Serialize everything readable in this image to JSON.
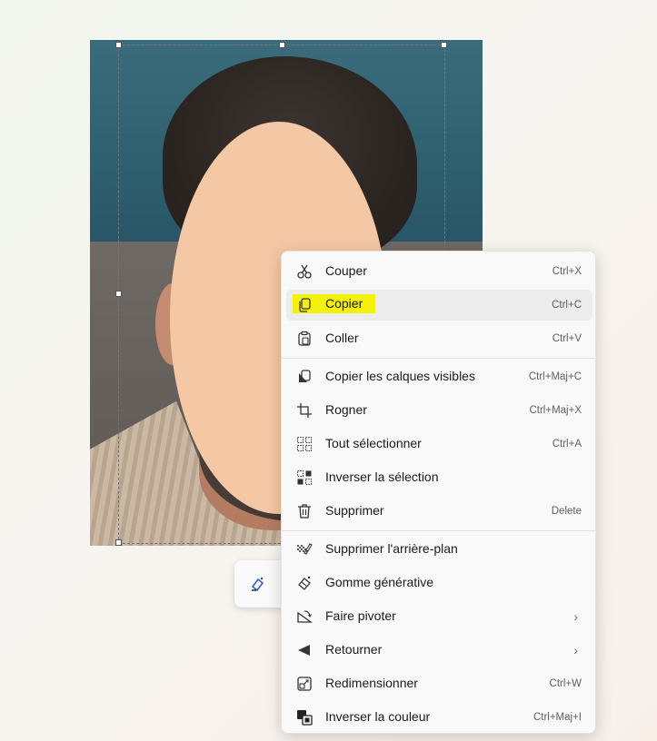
{
  "menu": {
    "items": [
      {
        "label": "Couper",
        "shortcut": "Ctrl+X",
        "icon": "scissors-icon"
      },
      {
        "label": "Copier",
        "shortcut": "Ctrl+C",
        "icon": "copy-icon",
        "highlighted": true
      },
      {
        "label": "Coller",
        "shortcut": "Ctrl+V",
        "icon": "paste-icon"
      },
      {
        "label": "Copier les calques visibles",
        "shortcut": "Ctrl+Maj+C",
        "icon": "copy-layers-icon"
      },
      {
        "label": "Rogner",
        "shortcut": "Ctrl+Maj+X",
        "icon": "crop-icon"
      },
      {
        "label": "Tout sélectionner",
        "shortcut": "Ctrl+A",
        "icon": "select-all-icon"
      },
      {
        "label": "Inverser la sélection",
        "shortcut": "",
        "icon": "invert-selection-icon"
      },
      {
        "label": "Supprimer",
        "shortcut": "Delete",
        "icon": "trash-icon"
      },
      {
        "label": "Supprimer l'arrière-plan",
        "shortcut": "",
        "icon": "remove-background-icon"
      },
      {
        "label": "Gomme générative",
        "shortcut": "",
        "icon": "generative-eraser-icon"
      },
      {
        "label": "Faire pivoter",
        "shortcut": "",
        "icon": "rotate-icon",
        "submenu": true
      },
      {
        "label": "Retourner",
        "shortcut": "",
        "icon": "flip-icon",
        "submenu": true
      },
      {
        "label": "Redimensionner",
        "shortcut": "Ctrl+W",
        "icon": "resize-icon"
      },
      {
        "label": "Inverser la couleur",
        "shortcut": "Ctrl+Maj+I",
        "icon": "invert-color-icon"
      }
    ],
    "submenu_glyph": "›"
  },
  "colors": {
    "highlight": "#f5f20a",
    "menu_bg": "#f9f9f9",
    "face_mask": "#f4c8a5"
  }
}
